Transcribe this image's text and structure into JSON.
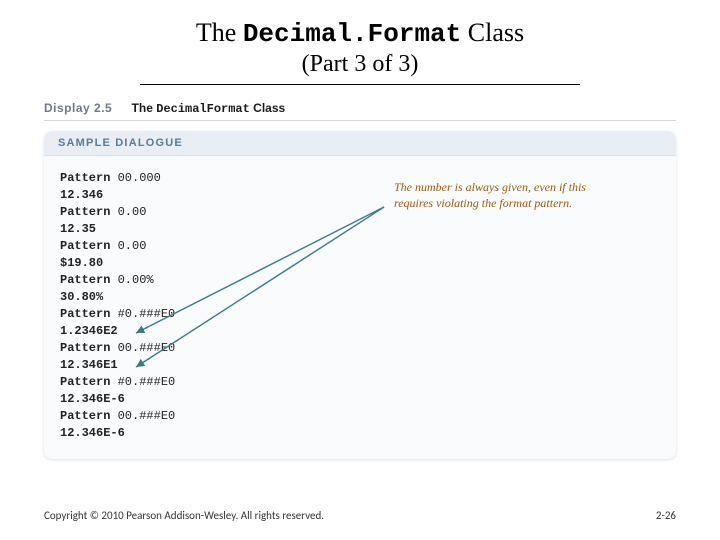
{
  "title_pre": "The ",
  "title_code": "Decimal.Format",
  "title_post": " Class",
  "subtitle": "(Part 3 of 3)",
  "display": {
    "label": "Display 2.5",
    "text_pre": "The ",
    "text_code": "DecimalFormat",
    "text_post": " Class"
  },
  "panel_header": "SAMPLE DIALOGUE",
  "lines": [
    {
      "label": "Pattern ",
      "arg": "00.000"
    },
    {
      "val": "12.346"
    },
    {
      "label": "Pattern ",
      "arg": "0.00"
    },
    {
      "val": "12.35"
    },
    {
      "label": "Pattern ",
      "arg": "0.00"
    },
    {
      "val": "$19.80"
    },
    {
      "label": "Pattern ",
      "arg": "0.00%"
    },
    {
      "val": "30.80%"
    },
    {
      "label": "Pattern ",
      "arg": "#0.###E0"
    },
    {
      "val": "1.2346E2"
    },
    {
      "label": "Pattern ",
      "arg": "00.###E0"
    },
    {
      "val": "12.346E1"
    },
    {
      "label": "Pattern ",
      "arg": "#0.###E0"
    },
    {
      "val": "12.346E-6"
    },
    {
      "label": "Pattern ",
      "arg": "00.###E0"
    },
    {
      "val": "12.346E-6"
    }
  ],
  "annotation": "The number is always given, even if this requires violating the format pattern.",
  "footer": {
    "copyright": "Copyright © 2010 Pearson Addison-Wesley. All rights reserved.",
    "page": "2-26"
  }
}
